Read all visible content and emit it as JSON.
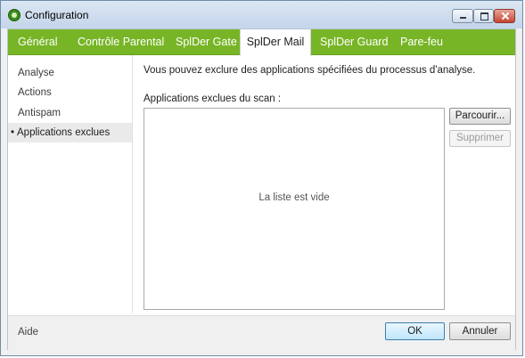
{
  "window": {
    "title": "Configuration"
  },
  "tabs": [
    {
      "label": "Général"
    },
    {
      "label": "Contrôle Parental"
    },
    {
      "label": "SplDer Gate"
    },
    {
      "label": "SplDer Mail",
      "active": true
    },
    {
      "label": "SplDer Guard"
    },
    {
      "label": "Pare-feu"
    }
  ],
  "sidebar": {
    "items": [
      {
        "label": "Analyse"
      },
      {
        "label": "Actions"
      },
      {
        "label": "Antispam"
      },
      {
        "label": "Applications exclues",
        "active": true
      }
    ],
    "bullet": "•"
  },
  "main": {
    "description": "Vous pouvez exclure des applications spécifiées du processus d'analyse.",
    "list_label": "Applications exclues du scan :",
    "list_empty_text": "La liste est vide",
    "browse_label": "Parcourir...",
    "remove_label": "Supprimer"
  },
  "footer": {
    "help_label": "Aide",
    "ok_label": "OK",
    "cancel_label": "Annuler"
  },
  "colors": {
    "accent": "#77b526",
    "titlebar": "#c4d5ea",
    "close_button": "#c7452f"
  },
  "icons": [
    "app-logo-icon",
    "minimize-icon",
    "maximize-icon",
    "close-icon"
  ]
}
